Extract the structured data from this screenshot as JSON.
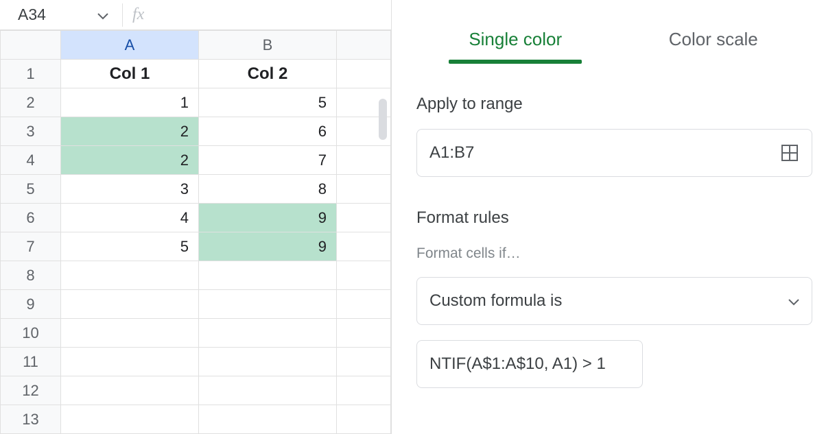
{
  "namebox": {
    "ref": "A34"
  },
  "formula_bar": {
    "value": ""
  },
  "columns": [
    {
      "letter": "A",
      "selected": true
    },
    {
      "letter": "B",
      "selected": false
    }
  ],
  "rows": [
    {
      "n": "1",
      "cells": [
        {
          "v": "Col 1",
          "header": true
        },
        {
          "v": "Col 2",
          "header": true
        }
      ]
    },
    {
      "n": "2",
      "cells": [
        {
          "v": "1"
        },
        {
          "v": "5"
        }
      ]
    },
    {
      "n": "3",
      "cells": [
        {
          "v": "2",
          "hl": true
        },
        {
          "v": "6"
        }
      ]
    },
    {
      "n": "4",
      "cells": [
        {
          "v": "2",
          "hl": true
        },
        {
          "v": "7"
        }
      ]
    },
    {
      "n": "5",
      "cells": [
        {
          "v": "3"
        },
        {
          "v": "8"
        }
      ]
    },
    {
      "n": "6",
      "cells": [
        {
          "v": "4"
        },
        {
          "v": "9",
          "hl": true
        }
      ]
    },
    {
      "n": "7",
      "cells": [
        {
          "v": "5"
        },
        {
          "v": "9",
          "hl": true
        }
      ]
    },
    {
      "n": "8",
      "cells": [
        {
          "v": ""
        },
        {
          "v": ""
        }
      ]
    },
    {
      "n": "9",
      "cells": [
        {
          "v": ""
        },
        {
          "v": ""
        }
      ]
    },
    {
      "n": "10",
      "cells": [
        {
          "v": ""
        },
        {
          "v": ""
        }
      ]
    },
    {
      "n": "11",
      "cells": [
        {
          "v": ""
        },
        {
          "v": ""
        }
      ]
    },
    {
      "n": "12",
      "cells": [
        {
          "v": ""
        },
        {
          "v": ""
        }
      ]
    },
    {
      "n": "13",
      "cells": [
        {
          "v": ""
        },
        {
          "v": ""
        }
      ]
    }
  ],
  "panel": {
    "tabs": {
      "single_color": "Single color",
      "color_scale": "Color scale",
      "active": "single_color"
    },
    "apply_label": "Apply to range",
    "range_value": "A1:B7",
    "format_rules_label": "Format rules",
    "format_cells_if_label": "Format cells if…",
    "condition_select_label": "Custom formula is",
    "formula_value": "NTIF(A$1:A$10, A1) > 1"
  }
}
